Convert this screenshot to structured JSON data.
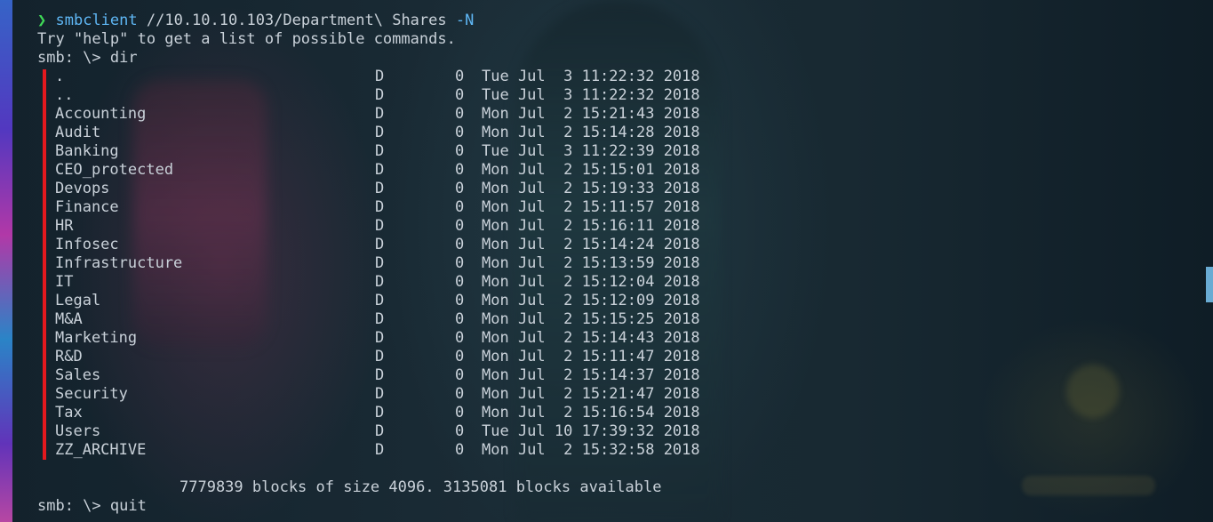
{
  "terminal": {
    "prompt_symbol": "❯",
    "command_name": "smbclient",
    "command_args": "//10.10.10.103/Department\\ Shares",
    "command_flag": "-N",
    "help_hint": "Try \"help\" to get a list of possible commands.",
    "smb_prompt_dir": "smb: \\> dir",
    "entries": [
      {
        "name": ".",
        "attr": "D",
        "size": "0",
        "date": "Tue Jul  3 11:22:32 2018"
      },
      {
        "name": "..",
        "attr": "D",
        "size": "0",
        "date": "Tue Jul  3 11:22:32 2018"
      },
      {
        "name": "Accounting",
        "attr": "D",
        "size": "0",
        "date": "Mon Jul  2 15:21:43 2018"
      },
      {
        "name": "Audit",
        "attr": "D",
        "size": "0",
        "date": "Mon Jul  2 15:14:28 2018"
      },
      {
        "name": "Banking",
        "attr": "D",
        "size": "0",
        "date": "Tue Jul  3 11:22:39 2018"
      },
      {
        "name": "CEO_protected",
        "attr": "D",
        "size": "0",
        "date": "Mon Jul  2 15:15:01 2018"
      },
      {
        "name": "Devops",
        "attr": "D",
        "size": "0",
        "date": "Mon Jul  2 15:19:33 2018"
      },
      {
        "name": "Finance",
        "attr": "D",
        "size": "0",
        "date": "Mon Jul  2 15:11:57 2018"
      },
      {
        "name": "HR",
        "attr": "D",
        "size": "0",
        "date": "Mon Jul  2 15:16:11 2018"
      },
      {
        "name": "Infosec",
        "attr": "D",
        "size": "0",
        "date": "Mon Jul  2 15:14:24 2018"
      },
      {
        "name": "Infrastructure",
        "attr": "D",
        "size": "0",
        "date": "Mon Jul  2 15:13:59 2018"
      },
      {
        "name": "IT",
        "attr": "D",
        "size": "0",
        "date": "Mon Jul  2 15:12:04 2018"
      },
      {
        "name": "Legal",
        "attr": "D",
        "size": "0",
        "date": "Mon Jul  2 15:12:09 2018"
      },
      {
        "name": "M&A",
        "attr": "D",
        "size": "0",
        "date": "Mon Jul  2 15:15:25 2018"
      },
      {
        "name": "Marketing",
        "attr": "D",
        "size": "0",
        "date": "Mon Jul  2 15:14:43 2018"
      },
      {
        "name": "R&D",
        "attr": "D",
        "size": "0",
        "date": "Mon Jul  2 15:11:47 2018"
      },
      {
        "name": "Sales",
        "attr": "D",
        "size": "0",
        "date": "Mon Jul  2 15:14:37 2018"
      },
      {
        "name": "Security",
        "attr": "D",
        "size": "0",
        "date": "Mon Jul  2 15:21:47 2018"
      },
      {
        "name": "Tax",
        "attr": "D",
        "size": "0",
        "date": "Mon Jul  2 15:16:54 2018"
      },
      {
        "name": "Users",
        "attr": "D",
        "size": "0",
        "date": "Tue Jul 10 17:39:32 2018"
      },
      {
        "name": "ZZ_ARCHIVE",
        "attr": "D",
        "size": "0",
        "date": "Mon Jul  2 15:32:58 2018"
      }
    ],
    "blocks_summary": "7779839 blocks of size 4096. 3135081 blocks available",
    "smb_prompt_quit": "smb: \\> quit"
  },
  "colors": {
    "prompt_arrow": "#3fd957",
    "command": "#5fb7f5",
    "text": "#c9d1d9",
    "highlight_bar": "#e5191e"
  }
}
